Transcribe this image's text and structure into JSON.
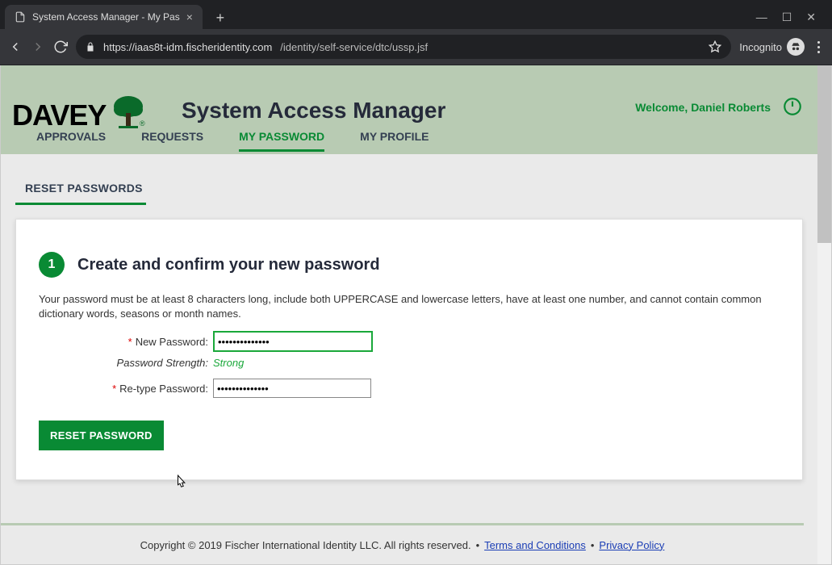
{
  "browser": {
    "tab_title": "System Access Manager - My Pas",
    "url_host": "https://iaas8t-idm.fischeridentity.com",
    "url_path": "/identity/self-service/dtc/ussp.jsf",
    "incognito_label": "Incognito"
  },
  "header": {
    "logo_text": "DAVEY",
    "app_title": "System Access Manager",
    "welcome": "Welcome, Daniel Roberts",
    "tabs": [
      "APPROVALS",
      "REQUESTS",
      "MY PASSWORD",
      "MY PROFILE"
    ],
    "active_tab_index": 2
  },
  "section": {
    "title": "RESET PASSWORDS",
    "step_number": "1",
    "step_title": "Create and confirm your new password",
    "description": "Your password must be at least 8 characters long, include both UPPERCASE and lowercase letters, have at least one number, and cannot contain common dictionary words, seasons or month names."
  },
  "form": {
    "new_password_label": "New Password:",
    "new_password_value": "••••••••••••••",
    "strength_label": "Password Strength:",
    "strength_value": "Strong",
    "retype_label": "Re-type Password:",
    "retype_value": "••••••••••••••",
    "submit_label": "RESET PASSWORD"
  },
  "footer": {
    "copyright": "Copyright © 2019 Fischer International Identity LLC. All rights reserved.",
    "terms": "Terms and Conditions",
    "privacy": "Privacy Policy"
  }
}
